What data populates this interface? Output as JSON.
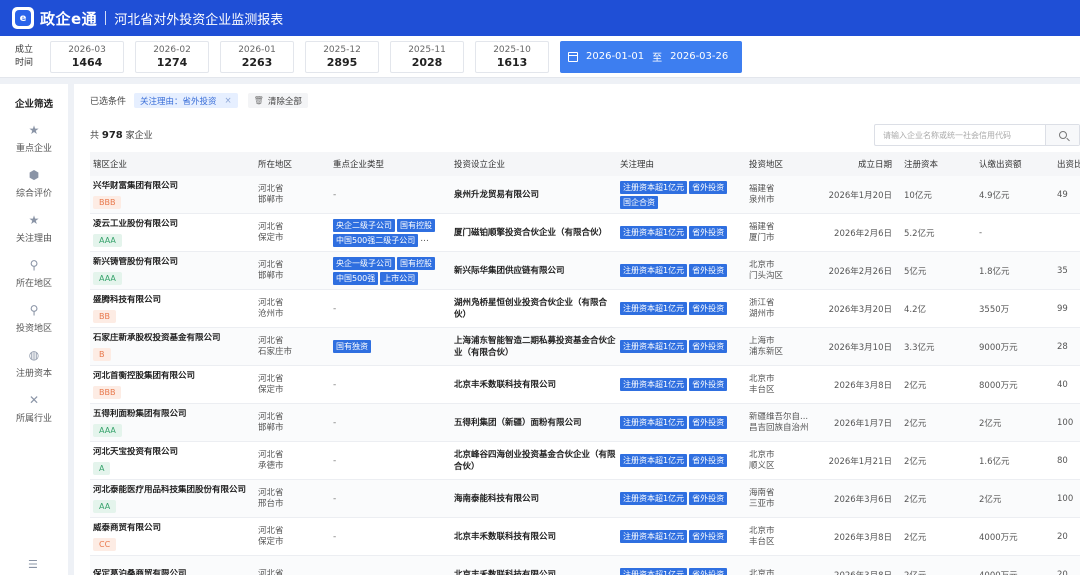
{
  "app": {
    "logo_char": "e",
    "name": "政企e通",
    "title": "河北省对外投资企业监测报表"
  },
  "stats": {
    "label": "成立\n时间",
    "months": [
      {
        "month": "2026-03",
        "count": "1464"
      },
      {
        "month": "2026-02",
        "count": "1274"
      },
      {
        "month": "2026-01",
        "count": "2263"
      },
      {
        "month": "2025-12",
        "count": "2895"
      },
      {
        "month": "2025-11",
        "count": "2028"
      },
      {
        "month": "2025-10",
        "count": "1613"
      }
    ],
    "date_from": "2026-01-01",
    "date_sep": "至",
    "date_to": "2026-03-26"
  },
  "sidebar": {
    "title": "企业筛选",
    "items": [
      {
        "label": "重点企业",
        "icon": "★"
      },
      {
        "label": "综合评价",
        "icon": "⬢"
      },
      {
        "label": "关注理由",
        "icon": "★"
      },
      {
        "label": "所在地区",
        "icon": "⚲"
      },
      {
        "label": "投资地区",
        "icon": "⚲"
      },
      {
        "label": "注册资本",
        "icon": "◍"
      },
      {
        "label": "所属行业",
        "icon": "✕"
      }
    ],
    "collapse_icon": "☰"
  },
  "filters": {
    "label": "已选条件",
    "chip": "关注理由：省外投资",
    "chip_close": "×",
    "clear": "清除全部",
    "trash_icon": "🗑"
  },
  "summary": {
    "prefix": "共",
    "count": "978",
    "suffix": "家企业"
  },
  "search": {
    "placeholder": "请输入企业名称或统一社会信用代码"
  },
  "table": {
    "headers": [
      "辖区企业",
      "所在地区",
      "重点企业类型",
      "投资设立企业",
      "关注理由",
      "投资地区",
      "成立日期",
      "注册资本",
      "认缴出资额",
      "出资比"
    ],
    "rows": [
      {
        "name": "兴华财富集团有限公司",
        "rating": "BBB",
        "region1": "河北省",
        "region2": "邯郸市",
        "types": [],
        "types_text": "-",
        "invest": "泉州升龙贸易有限公司",
        "reasons": [
          "注册资本超1亿元",
          "省外投资",
          "国企合资"
        ],
        "inv1": "福建省",
        "inv2": "泉州市",
        "date": "2026年1月20日",
        "capital": "10亿元",
        "sub": "4.9亿元",
        "ratio": "49"
      },
      {
        "name": "凌云工业股份有限公司",
        "rating": "AAA",
        "region1": "河北省",
        "region2": "保定市",
        "types": [
          "央企二级子公司",
          "国有控股",
          "中国500强二级子公司"
        ],
        "more": "...",
        "invest": "厦门磁铂顺擎投资合伙企业（有限合伙）",
        "reasons": [
          "注册资本超1亿元",
          "省外投资"
        ],
        "inv1": "福建省",
        "inv2": "厦门市",
        "date": "2026年2月6日",
        "capital": "5.2亿元",
        "sub": "-",
        "ratio": ""
      },
      {
        "name": "新兴铸管股份有限公司",
        "rating": "AAA",
        "region1": "河北省",
        "region2": "邯郸市",
        "types": [
          "央企一级子公司",
          "国有控股",
          "中国500强",
          "上市公司"
        ],
        "invest": "新兴际华集团供应链有限公司",
        "reasons": [
          "注册资本超1亿元",
          "省外投资"
        ],
        "inv1": "北京市",
        "inv2": "门头沟区",
        "date": "2026年2月26日",
        "capital": "5亿元",
        "sub": "1.8亿元",
        "ratio": "35"
      },
      {
        "name": "盛腾科技有限公司",
        "rating": "BB",
        "region1": "河北省",
        "region2": "沧州市",
        "types": [],
        "types_text": "-",
        "invest": "湖州凫桥星恒创业投资合伙企业（有限合伙）",
        "reasons": [
          "注册资本超1亿元",
          "省外投资"
        ],
        "inv1": "浙江省",
        "inv2": "湖州市",
        "date": "2026年3月20日",
        "capital": "4.2亿",
        "sub": "3550万",
        "ratio": "99"
      },
      {
        "name": "石家庄新承股权投资基金有限公司",
        "rating": "B",
        "region1": "河北省",
        "region2": "石家庄市",
        "types": [
          "国有独资"
        ],
        "invest": "上海浦东智能智造二期私募投资基金合伙企业（有限合伙）",
        "reasons": [
          "注册资本超1亿元",
          "省外投资"
        ],
        "inv1": "上海市",
        "inv2": "浦东新区",
        "date": "2026年3月10日",
        "capital": "3.3亿元",
        "sub": "9000万元",
        "ratio": "28"
      },
      {
        "name": "河北首衡控股集团有限公司",
        "rating": "BBB",
        "region1": "河北省",
        "region2": "保定市",
        "types": [],
        "types_text": "-",
        "invest": "北京丰禾数联科技有限公司",
        "reasons": [
          "注册资本超1亿元",
          "省外投资"
        ],
        "inv1": "北京市",
        "inv2": "丰台区",
        "date": "2026年3月8日",
        "capital": "2亿元",
        "sub": "8000万元",
        "ratio": "40"
      },
      {
        "name": "五得利面粉集团有限公司",
        "rating": "AAA",
        "region1": "河北省",
        "region2": "邯郸市",
        "types": [],
        "types_text": "-",
        "invest": "五得利集团（新疆）面粉有限公司",
        "reasons": [
          "注册资本超1亿元",
          "省外投资"
        ],
        "inv1": "新疆维吾尔自...",
        "inv2": "昌吉回族自治州",
        "date": "2026年1月7日",
        "capital": "2亿元",
        "sub": "2亿元",
        "ratio": "100"
      },
      {
        "name": "河北天宝投资有限公司",
        "rating": "A",
        "region1": "河北省",
        "region2": "承德市",
        "types": [],
        "types_text": "-",
        "invest": "北京峰谷四海创业投资基金合伙企业（有限合伙）",
        "reasons": [
          "注册资本超1亿元",
          "省外投资"
        ],
        "inv1": "北京市",
        "inv2": "顺义区",
        "date": "2026年1月21日",
        "capital": "2亿元",
        "sub": "1.6亿元",
        "ratio": "80"
      },
      {
        "name": "河北泰能医疗用品科技集团股份有限公司",
        "rating": "AA",
        "region1": "河北省",
        "region2": "邢台市",
        "types": [],
        "types_text": "-",
        "invest": "海南泰能科技有限公司",
        "reasons": [
          "注册资本超1亿元",
          "省外投资"
        ],
        "inv1": "海南省",
        "inv2": "三亚市",
        "date": "2026年3月6日",
        "capital": "2亿元",
        "sub": "2亿元",
        "ratio": "100"
      },
      {
        "name": "威泰商贸有限公司",
        "rating": "CC",
        "region1": "河北省",
        "region2": "保定市",
        "types": [],
        "types_text": "-",
        "invest": "北京丰禾数联科技有限公司",
        "reasons": [
          "注册资本超1亿元",
          "省外投资"
        ],
        "inv1": "北京市",
        "inv2": "丰台区",
        "date": "2026年3月8日",
        "capital": "2亿元",
        "sub": "4000万元",
        "ratio": "20"
      },
      {
        "name": "保定葛泊桑商贸有限公司",
        "rating": "",
        "region1": "河北省",
        "region2": "",
        "types": [],
        "types_text": "",
        "invest": "北京丰禾数联科技有限公司",
        "reasons": [
          "注册资本超1亿元",
          "省外投资"
        ],
        "inv1": "北京市",
        "inv2": "",
        "date": "2026年3月8日",
        "capital": "2亿元",
        "sub": "4000万元",
        "ratio": "20"
      }
    ]
  },
  "colors": {
    "header_bg": "#1f4fd6",
    "date_range_bg": "#3d7ef0",
    "tag_bg": "#2f6fe0"
  }
}
